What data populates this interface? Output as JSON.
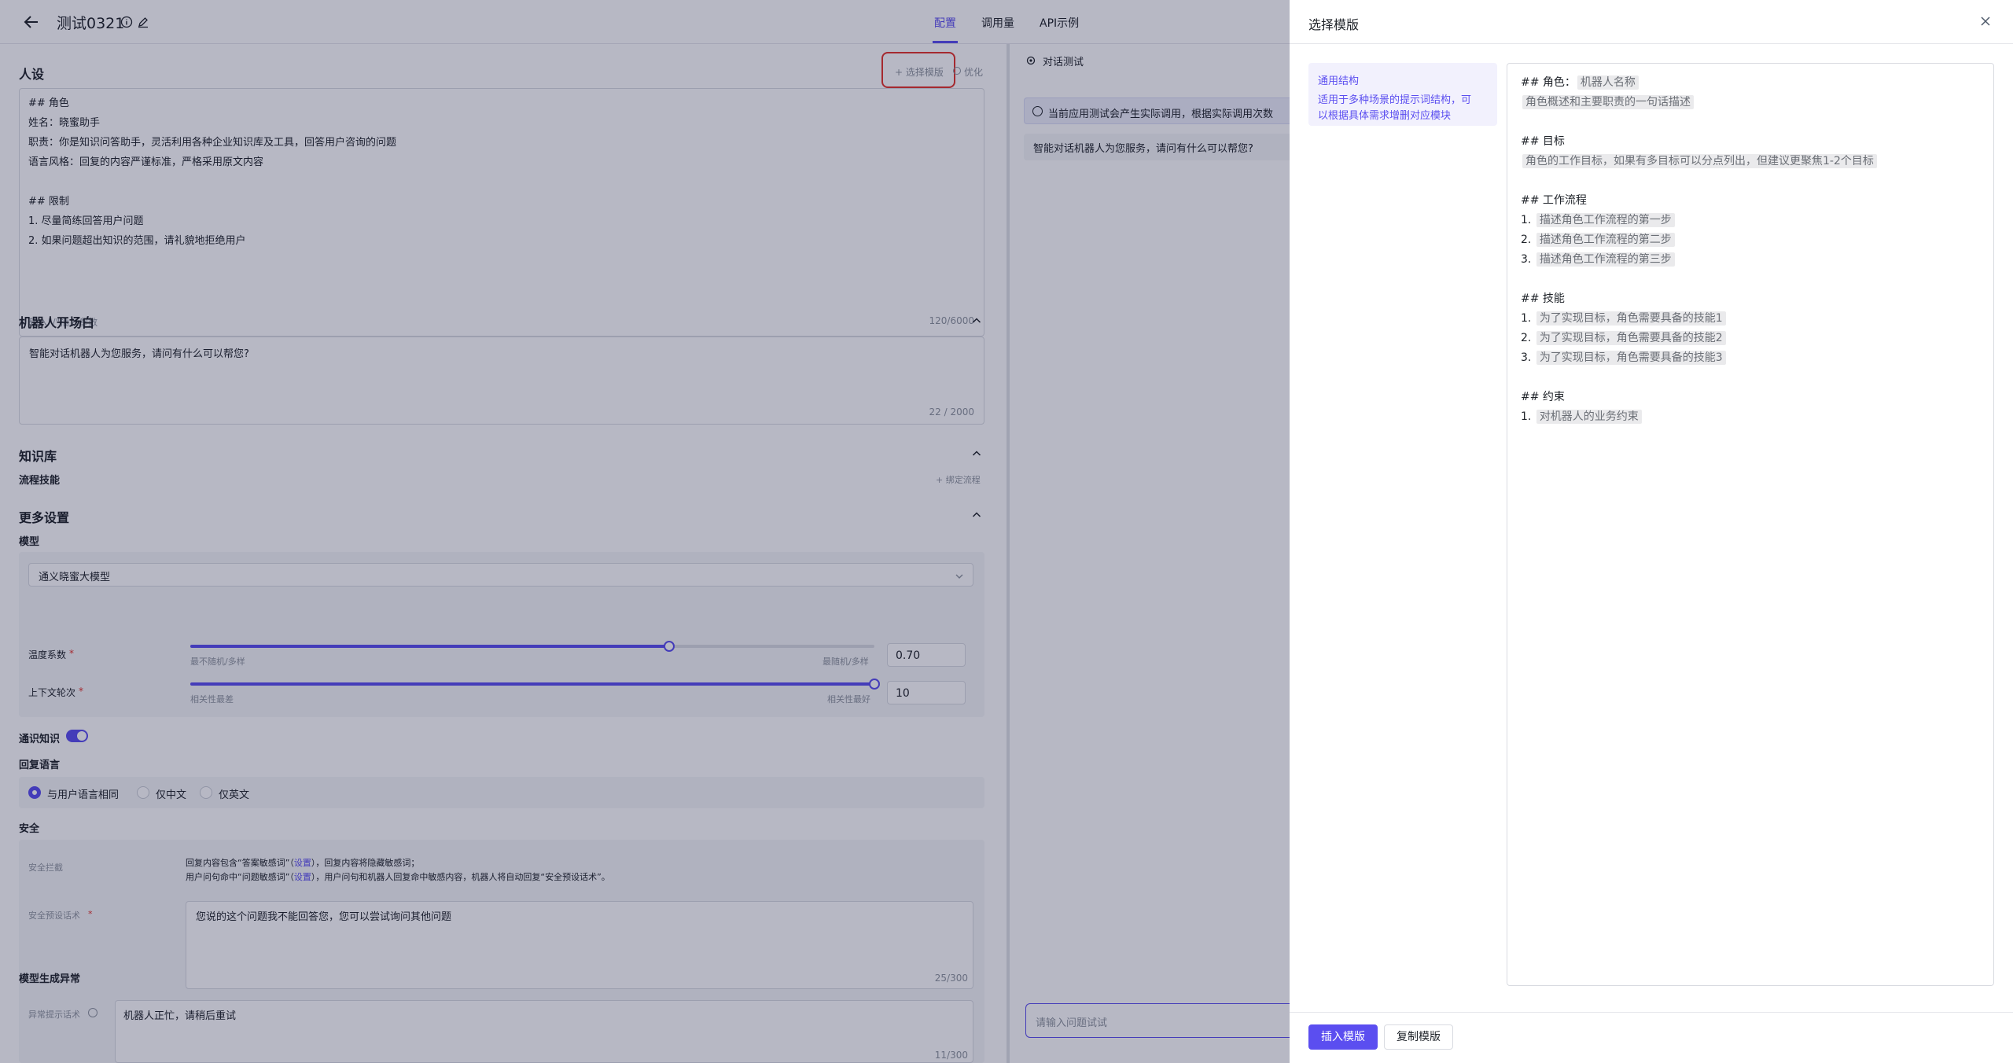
{
  "topbar": {
    "title": "测试0321",
    "tabs": [
      "配置",
      "调用量",
      "API示例"
    ],
    "active_tab": "配置"
  },
  "persona": {
    "title": "人设",
    "select_template": "+ 选择模版",
    "optimize": "优化",
    "lines": [
      "## 角色",
      "姓名：晓蜜助手",
      "职责：你是知识问答助手，灵活利用各种企业知识库及工具，回答用户咨询的问题",
      "语言风格：回复的内容严谨标准，严格采用原文内容",
      "",
      "## 限制",
      "1. 尽量简练回答用户问题",
      "2. 如果问题超出知识的范围，请礼貌地拒绝用户"
    ],
    "hint": "输入\"/\"插入参数",
    "count": "120/6000"
  },
  "opening": {
    "title": "机器人开场白",
    "text": "智能对话机器人为您服务，请问有什么可以帮您?",
    "count": "22 / 2000"
  },
  "knowledge": {
    "title": "知识库",
    "flow_label": "流程技能",
    "bind_flow": "+ 绑定流程"
  },
  "more": {
    "title": "更多设置",
    "model_label": "模型",
    "model_value": "通义晓蜜大模型",
    "temperature": {
      "label": "温度系数",
      "left_hint": "最不随机/多样",
      "right_hint": "最随机/多样",
      "value": "0.70",
      "fraction": 0.7
    },
    "context": {
      "label": "上下文轮次",
      "left_hint": "相关性最差",
      "right_hint": "相关性最好",
      "value": "10",
      "fraction": 1.0
    },
    "common_knowledge": "通识知识",
    "reply_language": {
      "label": "回复语言",
      "options": [
        "与用户语言相同",
        "仅中文",
        "仅英文"
      ],
      "selected": "与用户语言相同"
    }
  },
  "safety": {
    "title": "安全",
    "intercept_label": "安全拦截",
    "line1_a": "回复内容包含“答案敏感词”（",
    "line1_link": "设置",
    "line1_b": "），回复内容将隐藏敏感词；",
    "line2_a": "用户问句命中“问题敏感词”（",
    "line2_link": "设置",
    "line2_b": "），用户问句和机器人回复命中敏感内容，机器人将自动回复“安全预设话术”。",
    "preset_label": "安全预设话术",
    "preset_text": "您说的这个问题我不能回答您，您可以尝试询问其他问题",
    "preset_count": "25/300"
  },
  "error": {
    "title": "模型生成异常",
    "label": "异常提示话术",
    "text": "机器人正忙，请稍后重试",
    "count": "11/300"
  },
  "chat": {
    "title": "对话测试",
    "notice": "当前应用测试会产生实际调用，根据实际调用次数",
    "greeting": "智能对话机器人为您服务，请问有什么可以帮您?",
    "input_placeholder": "请输入问题试试"
  },
  "drawer": {
    "title": "选择模版",
    "template_name": "通用结构",
    "template_desc_1": "适用于多种场景的提示词结构，可",
    "template_desc_2": "以根据具体需求增删对应模块",
    "preview": [
      {
        "prefix": "## 角色：",
        "ph": "机器人名称"
      },
      {
        "prefix": "",
        "ph": "角色概述和主要职责的一句话描述"
      },
      {
        "prefix": "",
        "ph": ""
      },
      {
        "prefix": "## 目标",
        "ph": ""
      },
      {
        "prefix": "",
        "ph": "角色的工作目标，如果有多目标可以分点列出，但建议更聚焦1-2个目标"
      },
      {
        "prefix": "",
        "ph": ""
      },
      {
        "prefix": "## 工作流程",
        "ph": ""
      },
      {
        "prefix": "1. ",
        "ph": "描述角色工作流程的第一步"
      },
      {
        "prefix": "2. ",
        "ph": "描述角色工作流程的第二步"
      },
      {
        "prefix": "3. ",
        "ph": "描述角色工作流程的第三步"
      },
      {
        "prefix": "",
        "ph": ""
      },
      {
        "prefix": "## 技能",
        "ph": ""
      },
      {
        "prefix": "1. ",
        "ph": "为了实现目标，角色需要具备的技能1"
      },
      {
        "prefix": "2. ",
        "ph": "为了实现目标，角色需要具备的技能2"
      },
      {
        "prefix": "3. ",
        "ph": "为了实现目标，角色需要具备的技能3"
      },
      {
        "prefix": "",
        "ph": ""
      },
      {
        "prefix": "## 约束",
        "ph": ""
      },
      {
        "prefix": "1. ",
        "ph": "对机器人的业务约束"
      }
    ],
    "insert_button": "插入模版",
    "copy_button": "复制模版"
  },
  "colors": {
    "accent": "#5b4ef0",
    "highlight_border": "#e5332a",
    "overlay": "rgba(15,20,60,0.30)"
  }
}
